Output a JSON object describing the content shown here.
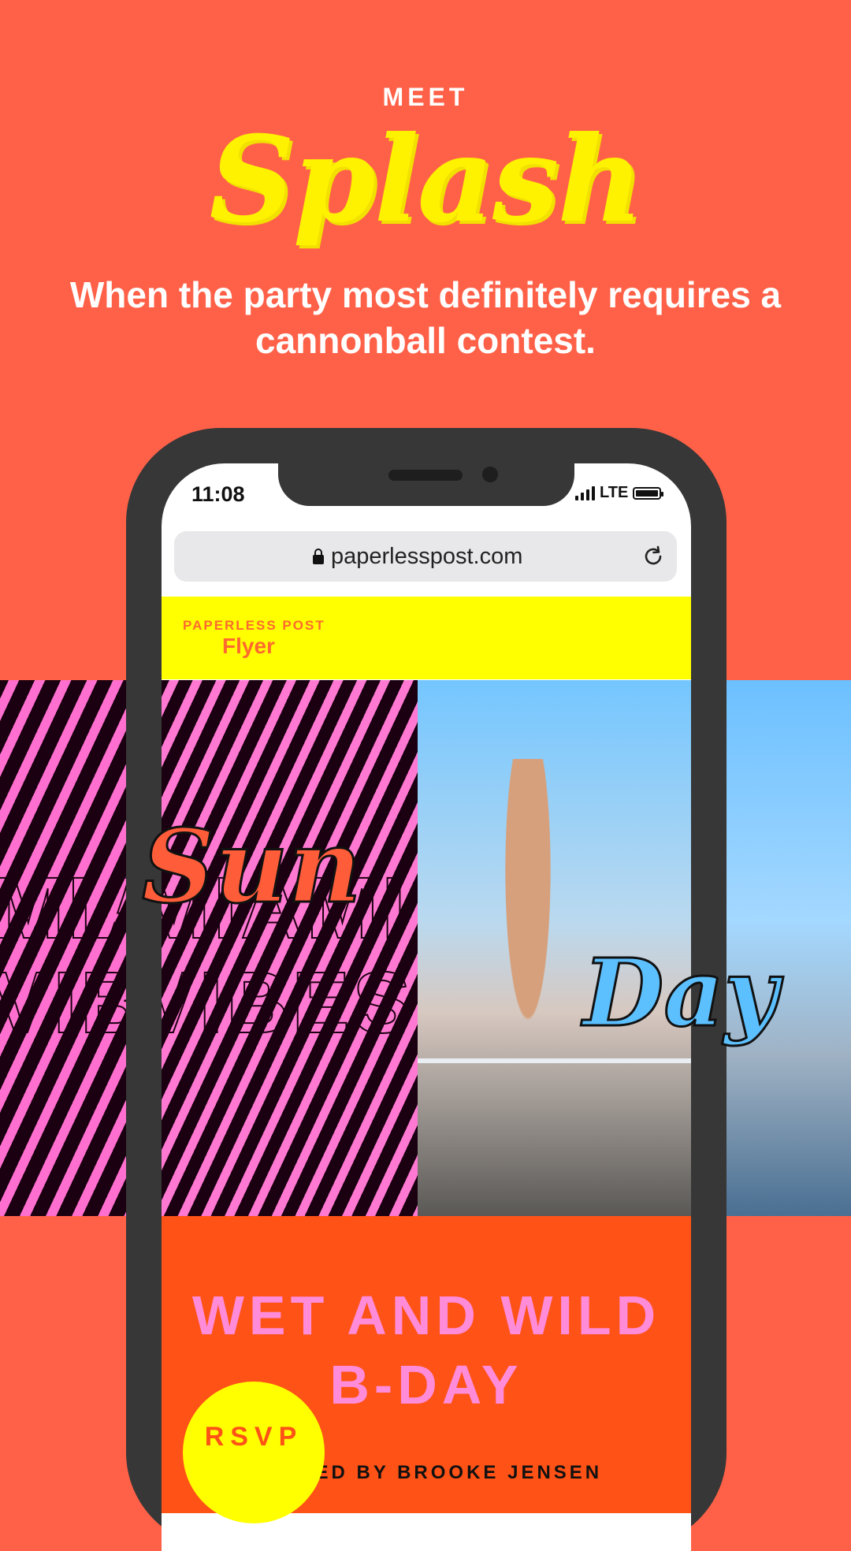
{
  "header": {
    "meet": "MEET",
    "logo": "Splash",
    "tagline": "When the party most definitely requires a cannonball contest."
  },
  "phone": {
    "status_time": "11:08",
    "network": "LTE",
    "url": "paperlesspost.com"
  },
  "site": {
    "brand_small": "PAPERLESS POST",
    "brand_name": "Flyer"
  },
  "flyer": {
    "photo_title_line1": "Sun",
    "photo_title_line2": "Day",
    "event_title": "WET AND WILD B-DAY",
    "hosted_by": "HOSTED BY BROOKE JENSEN",
    "rsvp_label": "RSVP"
  },
  "colors": {
    "background": "#ff6148",
    "logo": "#fff200",
    "sitebar": "#ffff00",
    "event_panel": "#ff5216",
    "event_title": "#ff8bd9"
  }
}
